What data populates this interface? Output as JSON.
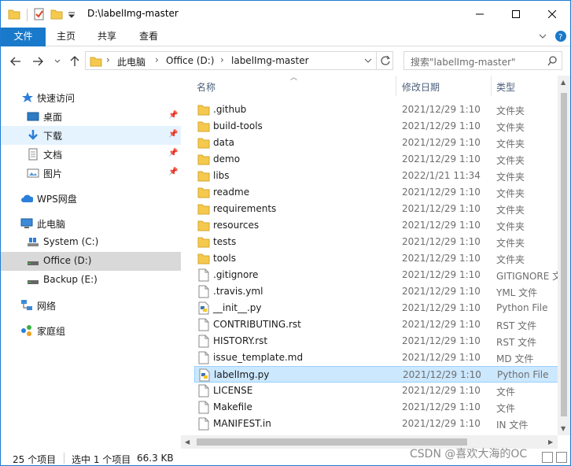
{
  "window": {
    "title": "D:\\labelImg-master"
  },
  "ribbon": {
    "tabs": [
      "文件",
      "主页",
      "共享",
      "查看"
    ]
  },
  "address": {
    "crumbs": [
      "此电脑",
      "Office (D:)",
      "labelImg-master"
    ]
  },
  "search": {
    "placeholder": "搜索\"labelImg-master\""
  },
  "nav": {
    "quick_access": "快速访问",
    "quick_items": [
      "桌面",
      "下载",
      "文档",
      "图片"
    ],
    "wps": "WPS网盘",
    "this_pc": "此电脑",
    "drives": [
      "System (C:)",
      "Office (D:)",
      "Backup (E:)"
    ],
    "network": "网络",
    "homegroup": "家庭组"
  },
  "columns": {
    "name": "名称",
    "date": "修改日期",
    "type": "类型"
  },
  "files": [
    {
      "name": ".github",
      "date": "2021/12/29 1:10",
      "type": "文件夹",
      "kind": "folder"
    },
    {
      "name": "build-tools",
      "date": "2021/12/29 1:10",
      "type": "文件夹",
      "kind": "folder"
    },
    {
      "name": "data",
      "date": "2021/12/29 1:10",
      "type": "文件夹",
      "kind": "folder"
    },
    {
      "name": "demo",
      "date": "2021/12/29 1:10",
      "type": "文件夹",
      "kind": "folder"
    },
    {
      "name": "libs",
      "date": "2022/1/21 11:34",
      "type": "文件夹",
      "kind": "folder"
    },
    {
      "name": "readme",
      "date": "2021/12/29 1:10",
      "type": "文件夹",
      "kind": "folder"
    },
    {
      "name": "requirements",
      "date": "2021/12/29 1:10",
      "type": "文件夹",
      "kind": "folder"
    },
    {
      "name": "resources",
      "date": "2021/12/29 1:10",
      "type": "文件夹",
      "kind": "folder"
    },
    {
      "name": "tests",
      "date": "2021/12/29 1:10",
      "type": "文件夹",
      "kind": "folder"
    },
    {
      "name": "tools",
      "date": "2021/12/29 1:10",
      "type": "文件夹",
      "kind": "folder"
    },
    {
      "name": ".gitignore",
      "date": "2021/12/29 1:10",
      "type": "GITIGNORE 文",
      "kind": "file"
    },
    {
      "name": ".travis.yml",
      "date": "2021/12/29 1:10",
      "type": "YML 文件",
      "kind": "file"
    },
    {
      "name": "__init__.py",
      "date": "2021/12/29 1:10",
      "type": "Python File",
      "kind": "python"
    },
    {
      "name": "CONTRIBUTING.rst",
      "date": "2021/12/29 1:10",
      "type": "RST 文件",
      "kind": "file"
    },
    {
      "name": "HISTORY.rst",
      "date": "2021/12/29 1:10",
      "type": "RST 文件",
      "kind": "file"
    },
    {
      "name": "issue_template.md",
      "date": "2021/12/29 1:10",
      "type": "MD 文件",
      "kind": "file"
    },
    {
      "name": "labelImg.py",
      "date": "2021/12/29 1:10",
      "type": "Python File",
      "kind": "python"
    },
    {
      "name": "LICENSE",
      "date": "2021/12/29 1:10",
      "type": "文件",
      "kind": "file"
    },
    {
      "name": "Makefile",
      "date": "2021/12/29 1:10",
      "type": "文件",
      "kind": "file"
    },
    {
      "name": "MANIFEST.in",
      "date": "2021/12/29 1:10",
      "type": "IN 文件",
      "kind": "file"
    }
  ],
  "selected_file": "labelImg.py",
  "status": {
    "count": "25 个项目",
    "selection": "选中 1 个项目",
    "size": "66.3 KB"
  },
  "watermark": "CSDN @喜欢大海的OC",
  "colors": {
    "accent": "#1979ca",
    "folder": "#f5c94e",
    "selected_row": "#cce8ff"
  }
}
